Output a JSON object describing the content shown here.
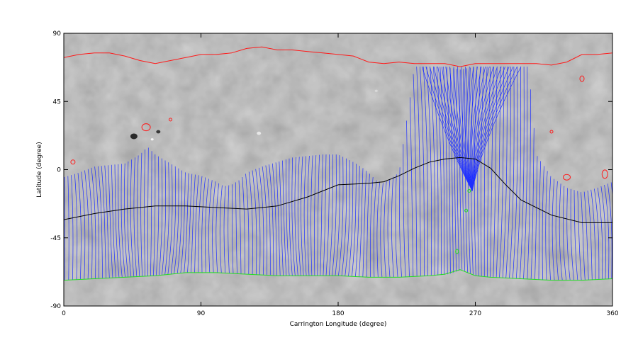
{
  "chart_data": {
    "type": "line",
    "title": "",
    "xlabel": "Carrington Longitude (degree)",
    "ylabel": "Latitude (degree)",
    "xlim": [
      0,
      360
    ],
    "ylim": [
      -90,
      90
    ],
    "xticks": [
      0,
      90,
      180,
      270,
      360
    ],
    "yticks": [
      90,
      45,
      0,
      -45,
      -90
    ],
    "grid": false,
    "legend": "none",
    "background": "grayscale magnetogram map",
    "colors": {
      "field_lines": "#1f2fff",
      "neutral_line": "#000000",
      "positive_contour": "#ff1a1a",
      "negative_contour": "#22dd22"
    },
    "series": [
      {
        "role": "neutral-line",
        "x": [
          0,
          20,
          40,
          60,
          80,
          100,
          120,
          140,
          160,
          180,
          200,
          210,
          220,
          230,
          240,
          250,
          260,
          270,
          280,
          290,
          300,
          320,
          340,
          360
        ],
        "y": [
          -33,
          -29,
          -26,
          -24,
          -24,
          -25,
          -26,
          -24,
          -18,
          -10,
          -9,
          -8,
          -4,
          1,
          5,
          7,
          8,
          7,
          1,
          -10,
          -20,
          -30,
          -35,
          -35
        ]
      },
      {
        "role": "north-red-contour",
        "x": [
          0,
          10,
          20,
          30,
          40,
          50,
          60,
          70,
          80,
          90,
          100,
          110,
          120,
          130,
          140,
          150,
          160,
          170,
          180,
          190,
          200,
          210,
          220,
          230,
          240,
          250,
          260,
          270,
          280,
          290,
          300,
          310,
          320,
          330,
          340,
          350,
          360
        ],
        "y": [
          74,
          76,
          77,
          77,
          75,
          72,
          70,
          72,
          74,
          76,
          76,
          77,
          80,
          81,
          79,
          79,
          78,
          77,
          76,
          75,
          71,
          70,
          71,
          70,
          70,
          70,
          68,
          70,
          70,
          70,
          70,
          70,
          69,
          71,
          76,
          76,
          77
        ]
      },
      {
        "role": "south-green-contour",
        "x": [
          0,
          20,
          40,
          60,
          80,
          100,
          120,
          140,
          160,
          180,
          200,
          220,
          240,
          250,
          260,
          270,
          280,
          300,
          320,
          340,
          360
        ],
        "y": [
          -73,
          -72,
          -71,
          -70,
          -68,
          -68,
          -69,
          -70,
          -70,
          -70,
          -71,
          -71,
          -70,
          -69,
          -66,
          -70,
          -71,
          -72,
          -73,
          -73,
          -72
        ]
      },
      {
        "role": "field-line-tops",
        "x": [
          0,
          10,
          20,
          30,
          40,
          50,
          55,
          60,
          70,
          80,
          90,
          100,
          105,
          110,
          115,
          120,
          130,
          140,
          150,
          160,
          170,
          180,
          190,
          195,
          200,
          205,
          210,
          220,
          230,
          240,
          250,
          260,
          270,
          280,
          290,
          300,
          305,
          310,
          320,
          330,
          340,
          350,
          360
        ],
        "y": [
          -5,
          -2,
          2,
          3,
          4,
          10,
          15,
          10,
          4,
          -2,
          -4,
          -8,
          -11,
          -10,
          -7,
          -2,
          2,
          5,
          8,
          9,
          10,
          10,
          5,
          2,
          -2,
          -7,
          -9,
          -2,
          68,
          68,
          68,
          66,
          68,
          68,
          68,
          68,
          68,
          10,
          -5,
          -12,
          -15,
          -12,
          -8
        ]
      },
      {
        "role": "field-line-bottoms",
        "x": [
          0,
          20,
          40,
          60,
          80,
          100,
          120,
          140,
          160,
          180,
          200,
          220,
          240,
          250,
          260,
          270,
          280,
          300,
          320,
          340,
          360
        ],
        "y": [
          -73,
          -72,
          -71,
          -70,
          -68,
          -68,
          -69,
          -70,
          -70,
          -70,
          -71,
          -71,
          -70,
          -69,
          -66,
          -70,
          -71,
          -72,
          -73,
          -73,
          -72
        ]
      }
    ]
  }
}
